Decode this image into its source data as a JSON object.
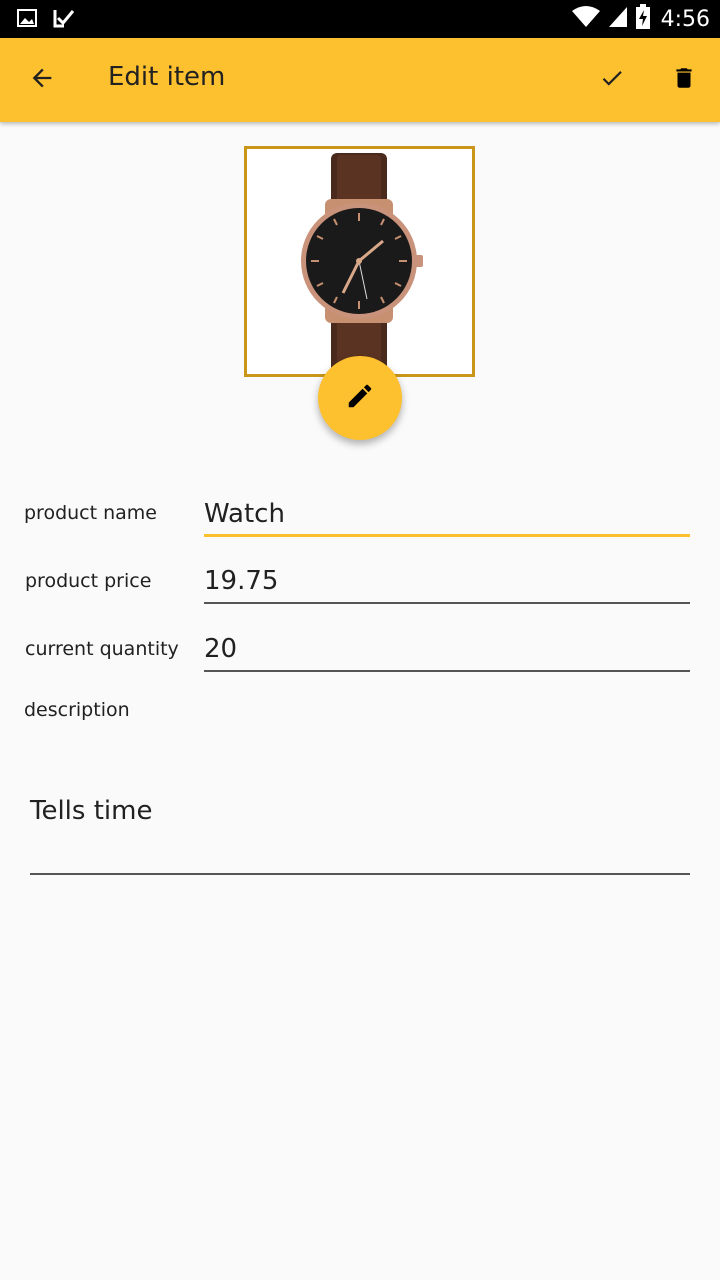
{
  "status_bar": {
    "time": "4:56",
    "icons": [
      "image-icon",
      "check-notification-icon",
      "wifi-icon",
      "signal-icon",
      "battery-charging-icon"
    ]
  },
  "app_bar": {
    "title": "Edit item",
    "back_icon": "arrow-back-icon",
    "save_icon": "check-icon",
    "delete_icon": "trash-icon",
    "color": "#fdc12f"
  },
  "product_image": {
    "alt": "watch-image",
    "edit_icon": "pencil-icon"
  },
  "form": {
    "name": {
      "label": "product name",
      "value": "Watch"
    },
    "price": {
      "label": "product price",
      "value": "19.75"
    },
    "quantity": {
      "label": "current quantity",
      "value": "20"
    },
    "description": {
      "label": "description",
      "value": "Tells time"
    }
  },
  "colors": {
    "accent": "#fdc12f",
    "frame": "#c9961a",
    "background": "#fafafa"
  }
}
